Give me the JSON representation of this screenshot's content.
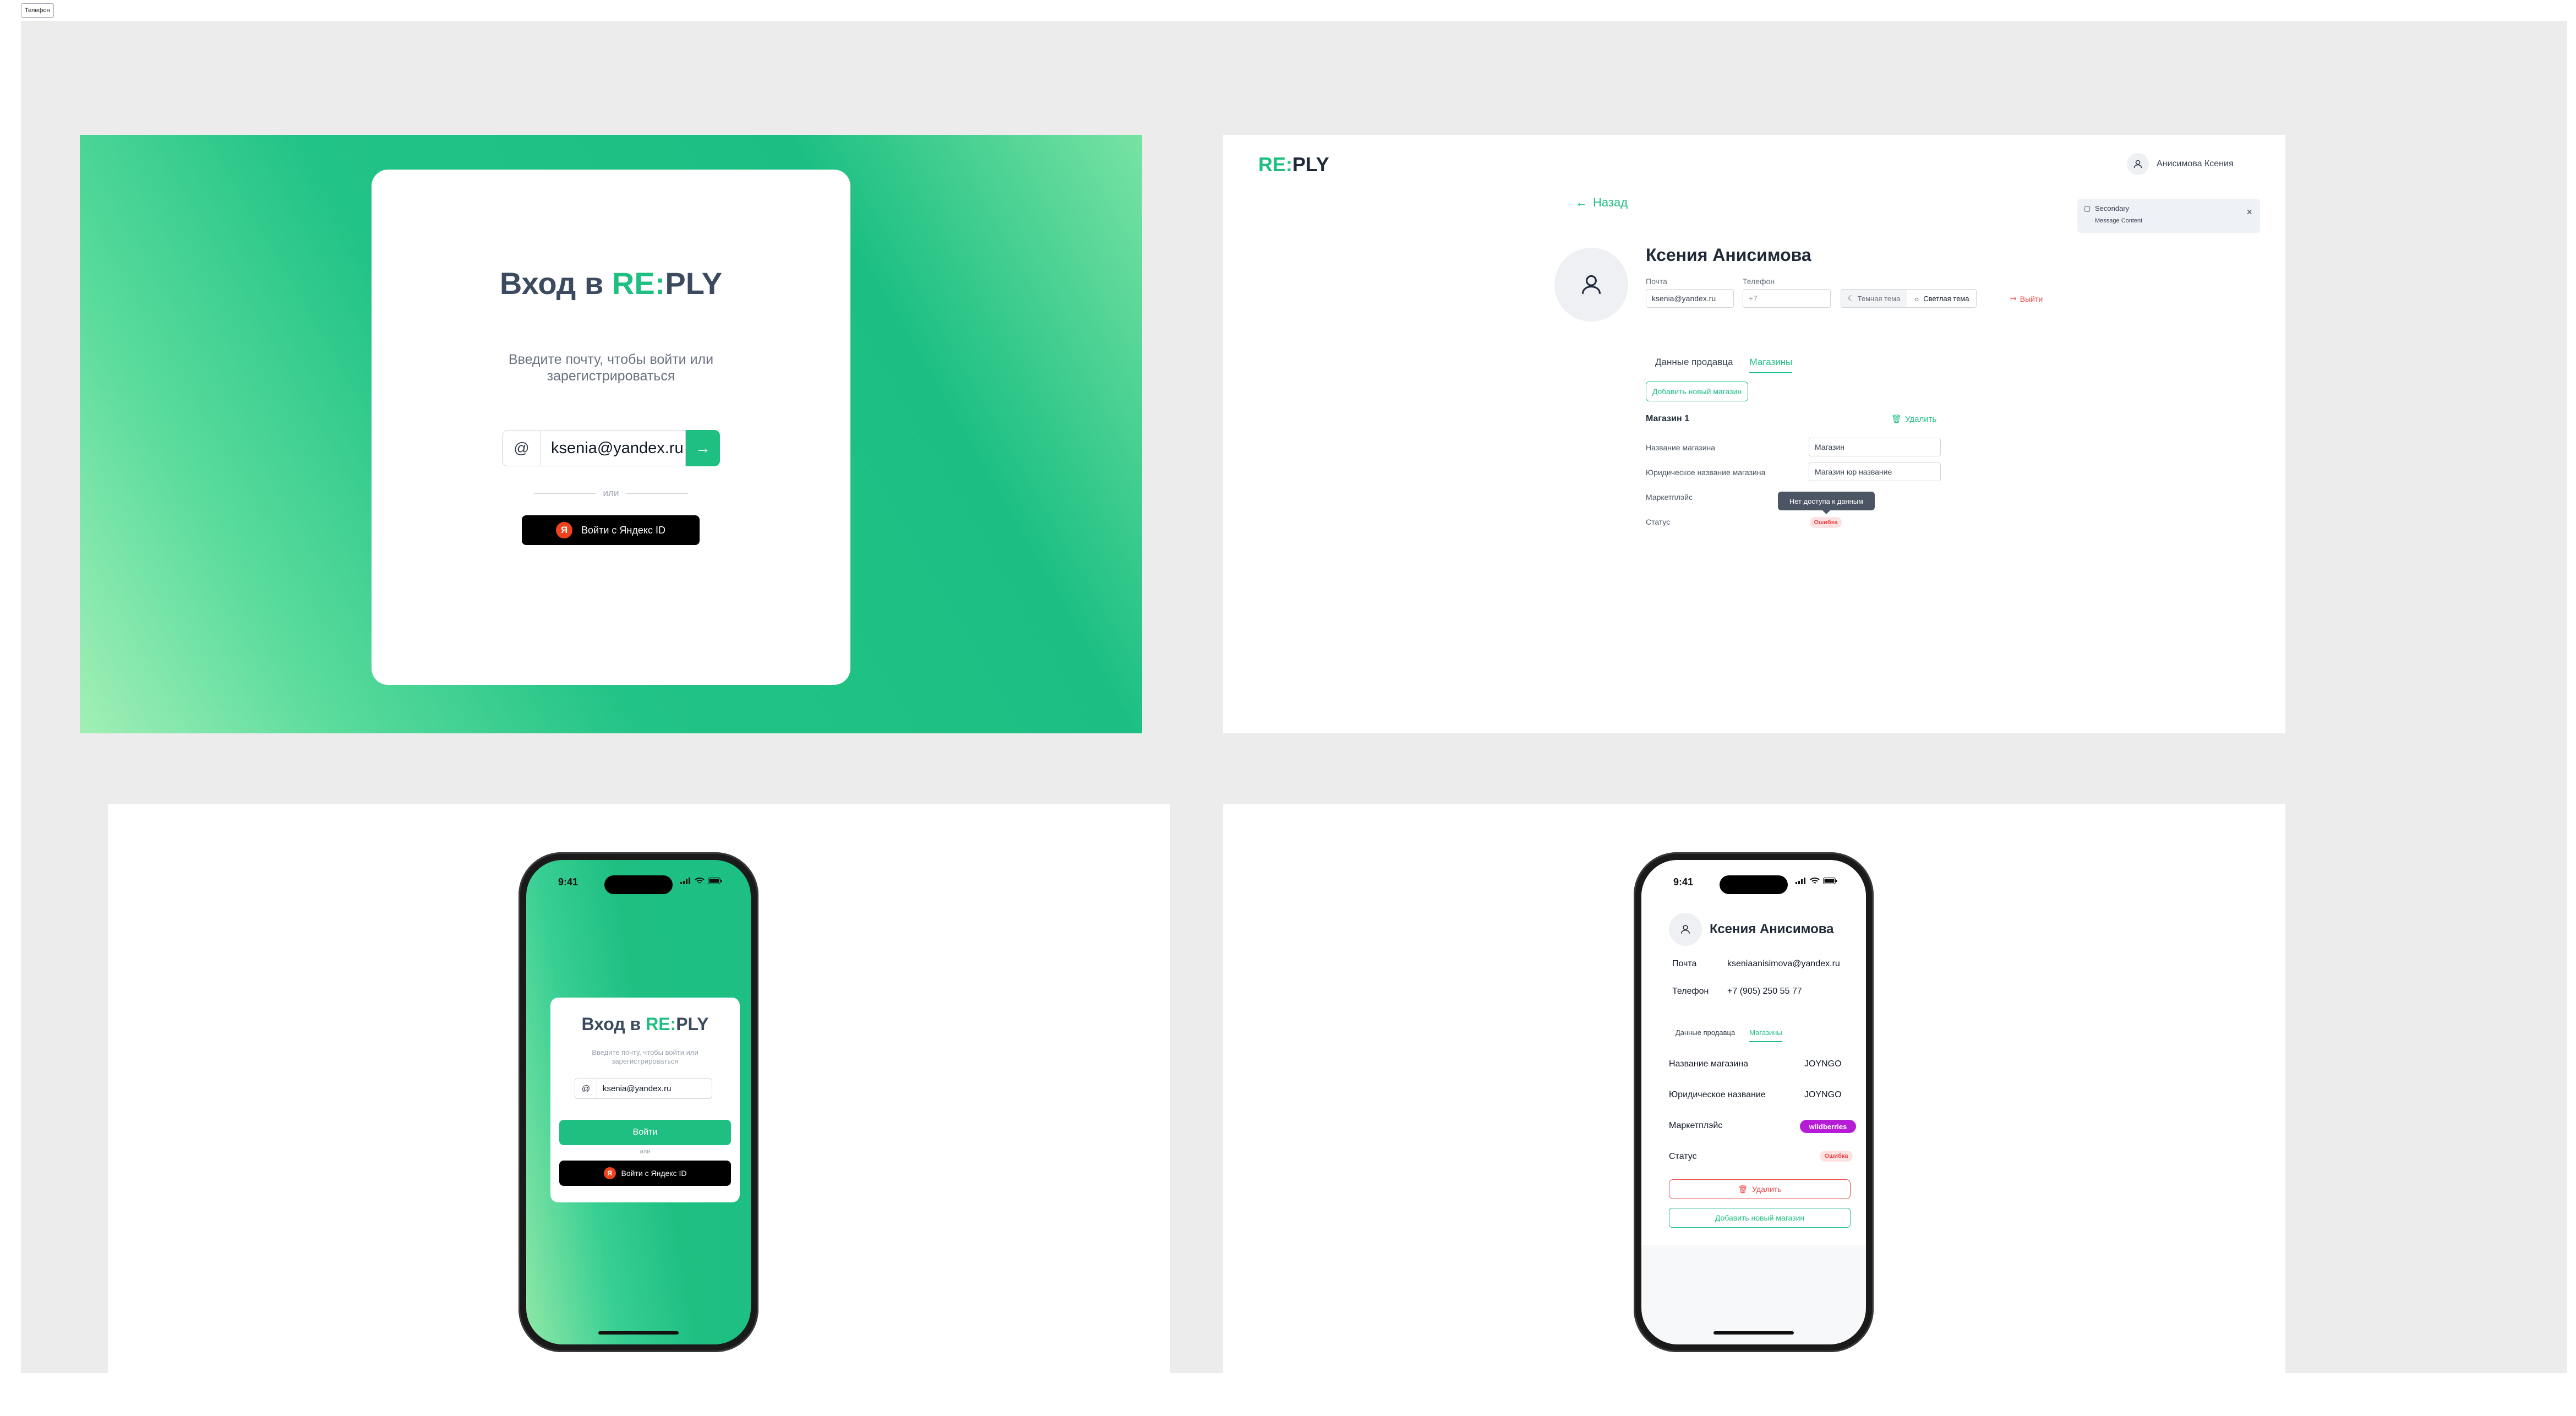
{
  "frame_tag": "Телефон",
  "brand": {
    "re": "RE",
    "colon": ":",
    "ply": "PLY"
  },
  "login": {
    "title_prefix": "Вход в ",
    "subtitle": "Введите почту, чтобы войти или зарегистрироваться",
    "at_symbol": "@",
    "email_value": "ksenia@yandex.ru",
    "submit_arrow": "→",
    "or_text": "или",
    "yandex_icon_letter": "Я",
    "yandex_button": "Войти с Яндекс ID"
  },
  "profile": {
    "user_name_short": "Анисимова Ксения",
    "back_label": "Назад",
    "toast_title": "Secondary",
    "toast_body": "Message Content",
    "full_name": "Ксения Анисимова",
    "email_label": "Почта",
    "email_value": "ksenia@yandex.ru",
    "phone_label": "Телефон",
    "phone_placeholder": "+7",
    "theme_dark": "Темная тема",
    "theme_light": "Светлая тема",
    "logout_label": "Выйти",
    "tab_seller": "Данные продавца",
    "tab_shops": "Магазины",
    "add_shop": "Добавить новый магазин",
    "shop_title": "Магазин 1",
    "delete_label": "Удалить",
    "shop_name_label": "Название магазина",
    "shop_name_value": "Магазин",
    "legal_name_label": "Юридическое название магазина",
    "legal_name_value": "Магазин юр название",
    "marketplace_label": "Маркетплэйс",
    "tooltip_text": "Нет доступа к данным",
    "status_label": "Статус",
    "status_error": "Ошибка"
  },
  "mobile_login": {
    "time": "9:41",
    "title_prefix": "Вход в ",
    "subtitle": "Введите почту, чтобы войти или зарегистрироваться",
    "at_symbol": "@",
    "email_value": "ksenia@yandex.ru",
    "login_button": "Войти",
    "or_text": "или",
    "yandex_icon_letter": "Я",
    "yandex_button": "Войти с Яндекс ID"
  },
  "mobile_profile": {
    "time": "9:41",
    "full_name": "Ксения Анисимова",
    "email_label": "Почта",
    "email_value": "kseniaanisimova@yandex.ru",
    "phone_label": "Телефон",
    "phone_value": "+7 (905) 250 55 77",
    "tab_seller": "Данные продавца",
    "tab_shops": "Магазины",
    "shop_name_label": "Название магазина",
    "shop_name_value": "JOYNGO",
    "legal_name_label": "Юридическое название",
    "legal_name_value": "JOYNGO",
    "marketplace_label": "Маркетплэйс",
    "marketplace_value": "wildberries",
    "status_label": "Статус",
    "status_error": "Ошибка",
    "delete_button": "Удалить",
    "add_shop_button": "Добавить новый магазин"
  },
  "colors": {
    "accent": "#1fbf82",
    "error": "#ef4444",
    "wildberries": "#b61cd6",
    "dark_text": "#3b4a5e"
  }
}
